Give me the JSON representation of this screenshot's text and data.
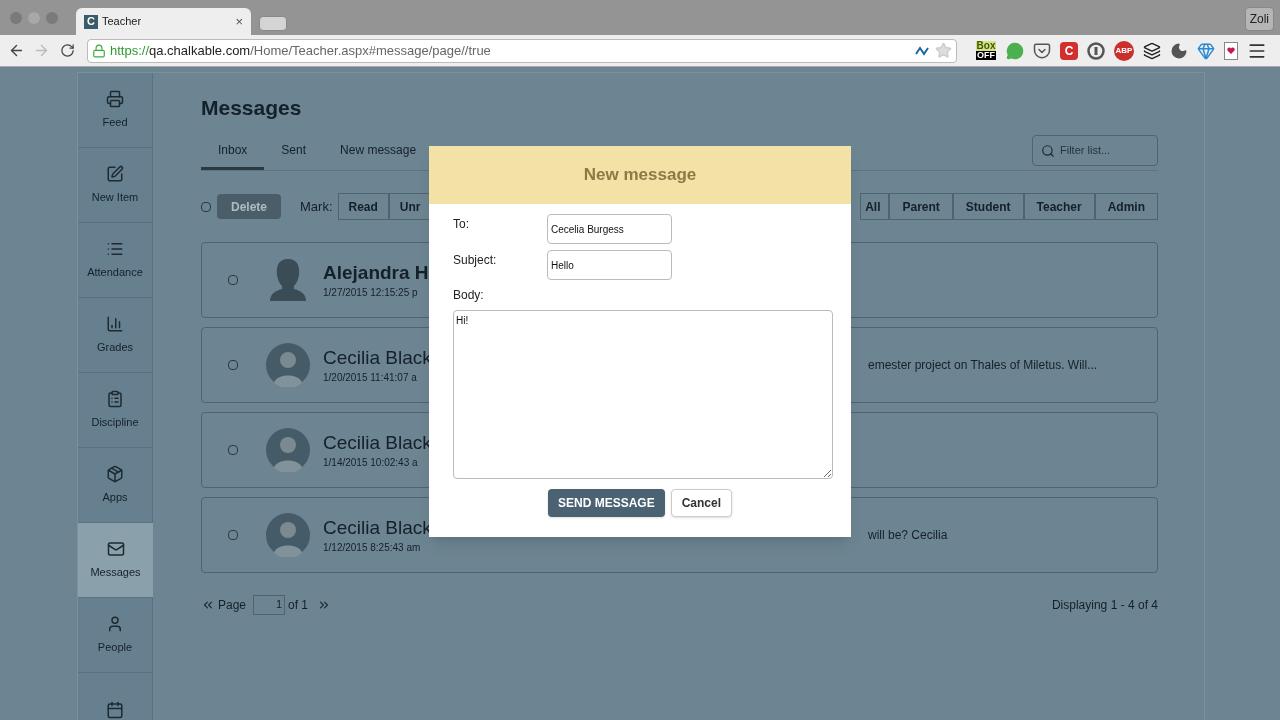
{
  "browser": {
    "tab": {
      "logo": "C",
      "title": "Teacher",
      "close": "×"
    },
    "profile": "Zoli",
    "url": {
      "scheme": "https://",
      "host": "qa.chalkable.com",
      "path": "/Home/Teacher.aspx#message/page//true"
    },
    "forward_disabled": true,
    "extensions": [
      {
        "kind": "box",
        "label": "Box",
        "sublabel": "OFF"
      },
      {
        "kind": "chat"
      },
      {
        "kind": "pocket"
      },
      {
        "kind": "letter",
        "label": "C"
      },
      {
        "kind": "ring"
      },
      {
        "kind": "abp",
        "label": "ABP"
      },
      {
        "kind": "layers"
      },
      {
        "kind": "moon"
      },
      {
        "kind": "gem"
      },
      {
        "kind": "card"
      },
      {
        "kind": "menu"
      }
    ]
  },
  "sidebar": {
    "items": [
      {
        "label": "Feed",
        "selected": false
      },
      {
        "label": "New Item",
        "selected": false
      },
      {
        "label": "Attendance",
        "selected": false
      },
      {
        "label": "Grades",
        "selected": false
      },
      {
        "label": "Discipline",
        "selected": false
      },
      {
        "label": "Apps",
        "selected": false
      },
      {
        "label": "Messages",
        "selected": true
      },
      {
        "label": "People",
        "selected": false
      },
      {
        "selected": false
      }
    ]
  },
  "page": {
    "title": "Messages",
    "tabs": [
      {
        "label": "Inbox",
        "selected": true
      },
      {
        "label": "Sent",
        "selected": false
      },
      {
        "label": "New message",
        "selected": false
      }
    ],
    "filter": {
      "placeholder": "Filter list..."
    },
    "toolbar": {
      "select_all_checked": false,
      "delete": "Delete",
      "mark_label": "Mark:",
      "mark_buttons": [
        "Read",
        "Unr"
      ],
      "role_buttons": [
        "All",
        "Parent",
        "Student",
        "Teacher",
        "Admin"
      ]
    },
    "messages": [
      {
        "kind": "silhouette",
        "checked": false,
        "name": "Alejandra H",
        "date": "1/27/2015 12:15:25 p",
        "unread": true
      },
      {
        "kind": "photo",
        "checked": false,
        "name": "Cecilia Black",
        "date": "1/20/2015 11:41:07 a",
        "unread": false,
        "preview": "emester project on Thales of Miletus. Will..."
      },
      {
        "kind": "photo",
        "checked": false,
        "name": "Cecilia Black",
        "date": "1/14/2015 10:02:43 a",
        "unread": false
      },
      {
        "kind": "photo",
        "checked": false,
        "name": "Cecilia Black",
        "date": "1/12/2015 8:25:43 am",
        "unread": false,
        "preview": "will be? Cecilia"
      }
    ],
    "pager": {
      "label": "Page",
      "value": "1",
      "of": "of 1",
      "summary": "Displaying 1 - 4 of 4"
    }
  },
  "dialog": {
    "title": "New message",
    "to_label": "To:",
    "to_value": "Cecelia Burgess",
    "subject_label": "Subject:",
    "subject_value": "Hello",
    "body_label": "Body:",
    "body_value": "Hi!",
    "send": "SEND MESSAGE",
    "cancel": "Cancel"
  }
}
